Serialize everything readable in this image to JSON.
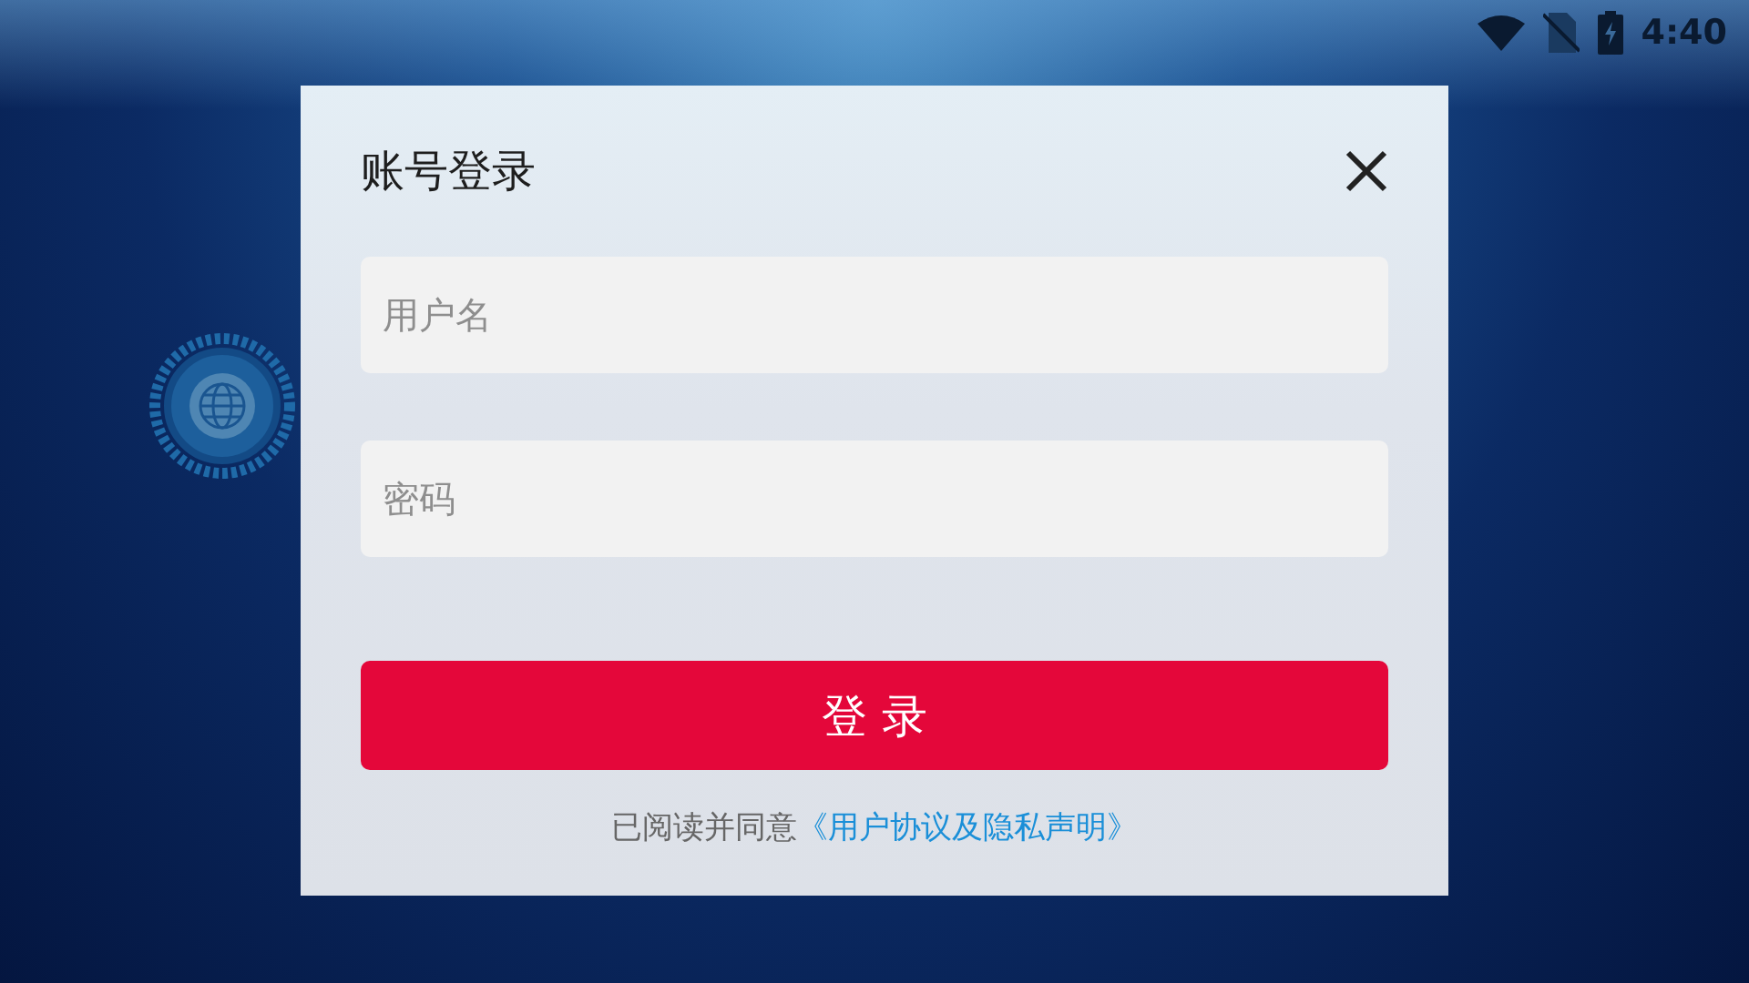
{
  "status_bar": {
    "time": "4:40"
  },
  "dialog": {
    "title": "账号登录",
    "username": {
      "placeholder": "用户名"
    },
    "password": {
      "placeholder": "密码"
    },
    "submit": "登 录",
    "agreement": {
      "text": "已阅读并同意",
      "link": "《用户协议及隐私声明》"
    }
  }
}
